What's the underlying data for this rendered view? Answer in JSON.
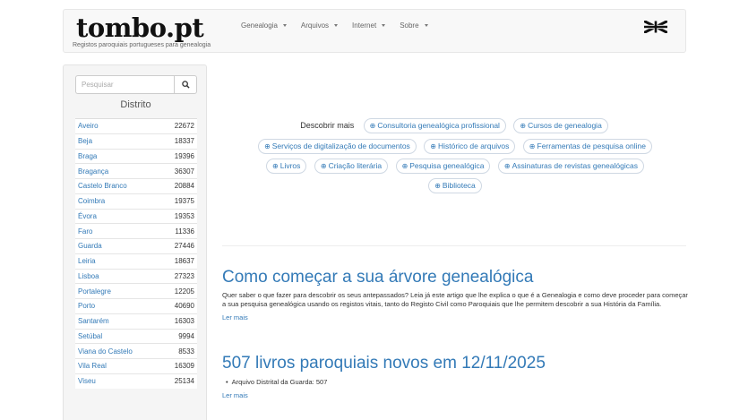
{
  "navbar": {
    "brand": "tombo.pt",
    "tagline": "Registos paroquiais portugueses para genealogia",
    "menu": [
      {
        "label": "Genealogia"
      },
      {
        "label": "Arquivos"
      },
      {
        "label": "Internet"
      },
      {
        "label": "Sobre"
      }
    ],
    "language_icon": "uk-flag-icon"
  },
  "sidebar": {
    "search_placeholder": "Pesquisar",
    "heading": "Distrito",
    "districts": [
      {
        "name": "Aveiro",
        "count": "22672"
      },
      {
        "name": "Beja",
        "count": "18337"
      },
      {
        "name": "Braga",
        "count": "19396"
      },
      {
        "name": "Bragança",
        "count": "36307"
      },
      {
        "name": "Castelo Branco",
        "count": "20884"
      },
      {
        "name": "Coimbra",
        "count": "19375"
      },
      {
        "name": "Évora",
        "count": "19353"
      },
      {
        "name": "Faro",
        "count": "11336"
      },
      {
        "name": "Guarda",
        "count": "27446"
      },
      {
        "name": "Leiria",
        "count": "18637"
      },
      {
        "name": "Lisboa",
        "count": "27323"
      },
      {
        "name": "Portalegre",
        "count": "12205"
      },
      {
        "name": "Porto",
        "count": "40690"
      },
      {
        "name": "Santarém",
        "count": "16303"
      },
      {
        "name": "Setúbal",
        "count": "9994"
      },
      {
        "name": "Viana do Castelo",
        "count": "8533"
      },
      {
        "name": "Vila Real",
        "count": "16309"
      },
      {
        "name": "Viseu",
        "count": "25134"
      }
    ]
  },
  "discover": {
    "label": "Descobrir mais",
    "pills": [
      "Consultoria genealógica profissional",
      "Cursos de genealogia",
      "Serviços de digitalização de documentos",
      "Histórico de arquivos",
      "Ferramentas de pesquisa online",
      "Livros",
      "Criação literária",
      "Pesquisa genealógica",
      "Assinaturas de revistas genealógicas",
      "Biblioteca"
    ]
  },
  "articles": [
    {
      "title": "Como começar a sua árvore genealógica",
      "text": "Quer saber o que fazer para descobrir os seus antepassados? Leia já este artigo que lhe explica o que é a Genealogia e como deve proceder para começar a sua pesquisa genealógica usando os registos vitais, tanto do Registo Civil como Paroquiais que lhe permitem descobrir a sua História da Família.",
      "more": "Ler mais"
    },
    {
      "title": "507 livros paroquiais novos em 12/11/2025",
      "items": [
        "Arquivo Distrital da Guarda: 507"
      ],
      "more": "Ler mais"
    }
  ],
  "colors": {
    "link": "#337ab7",
    "navbar_bg": "#f8f8f8",
    "sidebar_bg": "#f5f5f5"
  }
}
